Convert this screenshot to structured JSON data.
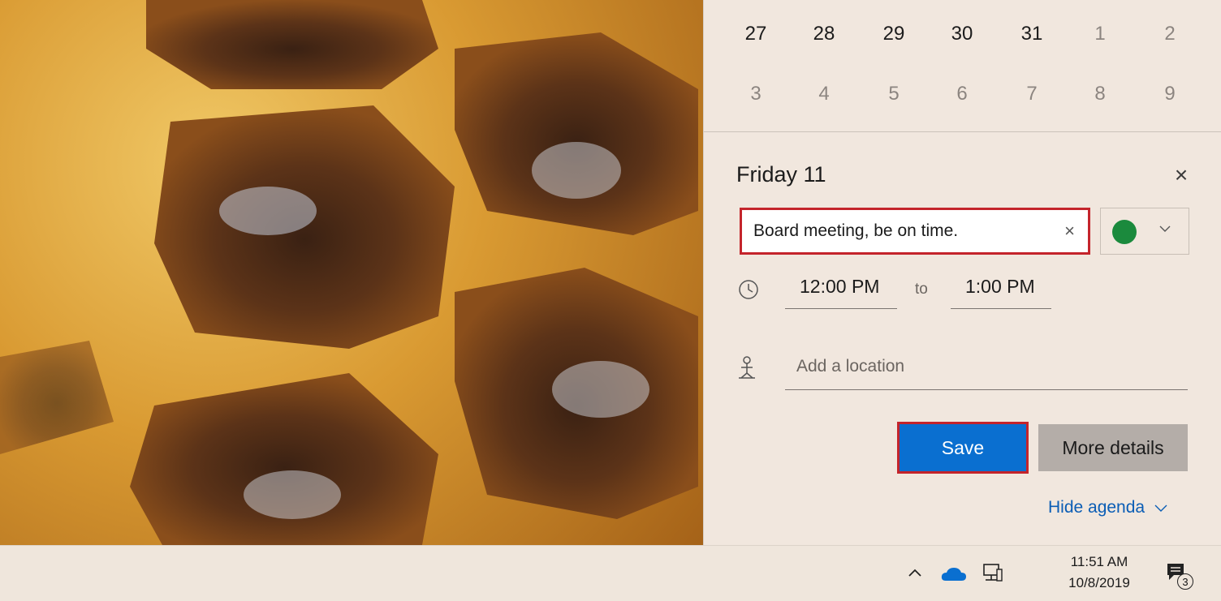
{
  "calendar": {
    "rows": [
      [
        {
          "d": "27",
          "dim": false
        },
        {
          "d": "28",
          "dim": false
        },
        {
          "d": "29",
          "dim": false
        },
        {
          "d": "30",
          "dim": false
        },
        {
          "d": "31",
          "dim": false
        },
        {
          "d": "1",
          "dim": true
        },
        {
          "d": "2",
          "dim": true
        }
      ],
      [
        {
          "d": "3",
          "dim": true
        },
        {
          "d": "4",
          "dim": true
        },
        {
          "d": "5",
          "dim": true
        },
        {
          "d": "6",
          "dim": true
        },
        {
          "d": "7",
          "dim": true
        },
        {
          "d": "8",
          "dim": true
        },
        {
          "d": "9",
          "dim": true
        }
      ]
    ]
  },
  "event": {
    "day_title": "Friday 11",
    "close_glyph": "×",
    "title_value": "Board meeting, be on time.",
    "clear_glyph": "×",
    "color": "#1b8a3d",
    "start_time": "12:00 PM",
    "to_label": "to",
    "end_time": "1:00 PM",
    "location_placeholder": "Add a location",
    "save_label": "Save",
    "more_label": "More details",
    "hide_agenda_label": "Hide agenda"
  },
  "taskbar": {
    "time": "11:51 AM",
    "date": "10/8/2019",
    "notification_count": "3"
  },
  "colors": {
    "accent": "#0a6fd0",
    "highlight": "#c4242b"
  }
}
